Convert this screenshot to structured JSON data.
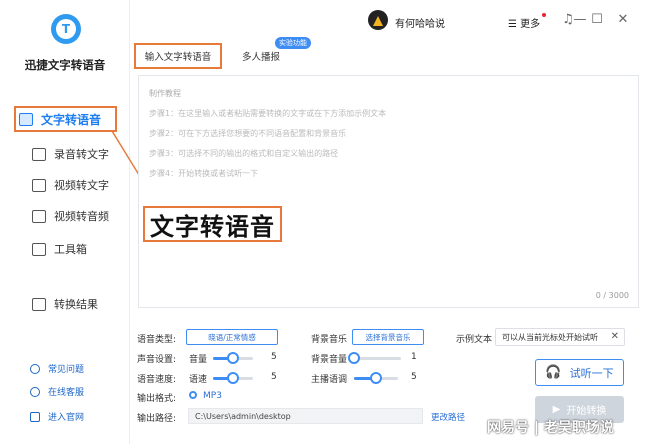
{
  "app": {
    "name": "迅捷文字转语音",
    "logo_letter": "T"
  },
  "sidebar": {
    "items": [
      {
        "label": "文字转语音",
        "icon": "text-to-speech-icon"
      },
      {
        "label": "录音转文字",
        "icon": "recording-icon"
      },
      {
        "label": "视频转文字",
        "icon": "video-text-icon"
      },
      {
        "label": "视频转音频",
        "icon": "video-audio-icon"
      },
      {
        "label": "工具箱",
        "icon": "toolbox-icon"
      },
      {
        "label": "转换结果",
        "icon": "results-icon"
      }
    ],
    "bottom_links": [
      {
        "label": "常见问题",
        "icon": "help-icon"
      },
      {
        "label": "在线客服",
        "icon": "headset-icon"
      },
      {
        "label": "进入官网",
        "icon": "website-icon"
      }
    ]
  },
  "titlebar": {
    "username": "有何哈哈说",
    "more_label": "更多"
  },
  "tabs": [
    {
      "label": "输入文字转语音"
    },
    {
      "label": "多人播报"
    }
  ],
  "tabs_tag": "实验功能",
  "editor": {
    "guide_title": "制作教程",
    "steps": [
      "步骤1：在这里输入或者粘贴需要转换的文字或在下方添加示例文本",
      "步骤2：可在下方选择您想要的不同语音配置和背景音乐",
      "步骤3：可选择不同的输出的格式和自定义输出的路径",
      "步骤4：开始转换或者试听一下"
    ],
    "counter": "0 / 3000"
  },
  "annotation": {
    "big_label": "文字转语音"
  },
  "settings": {
    "voice_type_label": "语音类型:",
    "voice_type_value": "晓语/正常情感",
    "bg_music_label": "背景音乐",
    "bg_music_button": "选择背景音乐",
    "sample_label": "示例文本",
    "sample_value": "可以从当前光标处开始试听",
    "sound_setting_label": "声音设置:",
    "volume_label": "音量",
    "volume_value": "5",
    "volume_fraction": 0.5,
    "bg_volume_label": "背景音量",
    "bg_volume_value": "1",
    "bg_volume_fraction": 0.1,
    "speed_label": "语音速度:",
    "rate_label": "语速",
    "rate_value": "5",
    "rate_fraction": 0.5,
    "tone_label": "主播语调",
    "tone_value": "5",
    "tone_fraction": 0.5,
    "format_label": "输出格式:",
    "format_value": "MP3",
    "path_label": "输出路径:",
    "path_value": "C:\\Users\\admin\\desktop",
    "change_path": "更改路径"
  },
  "actions": {
    "listen": "试听一下",
    "start": "开始转换"
  },
  "watermark": "网易号 | 老吴职场说",
  "colors": {
    "accent": "#3d8df5",
    "highlight": "#e77a3a"
  }
}
